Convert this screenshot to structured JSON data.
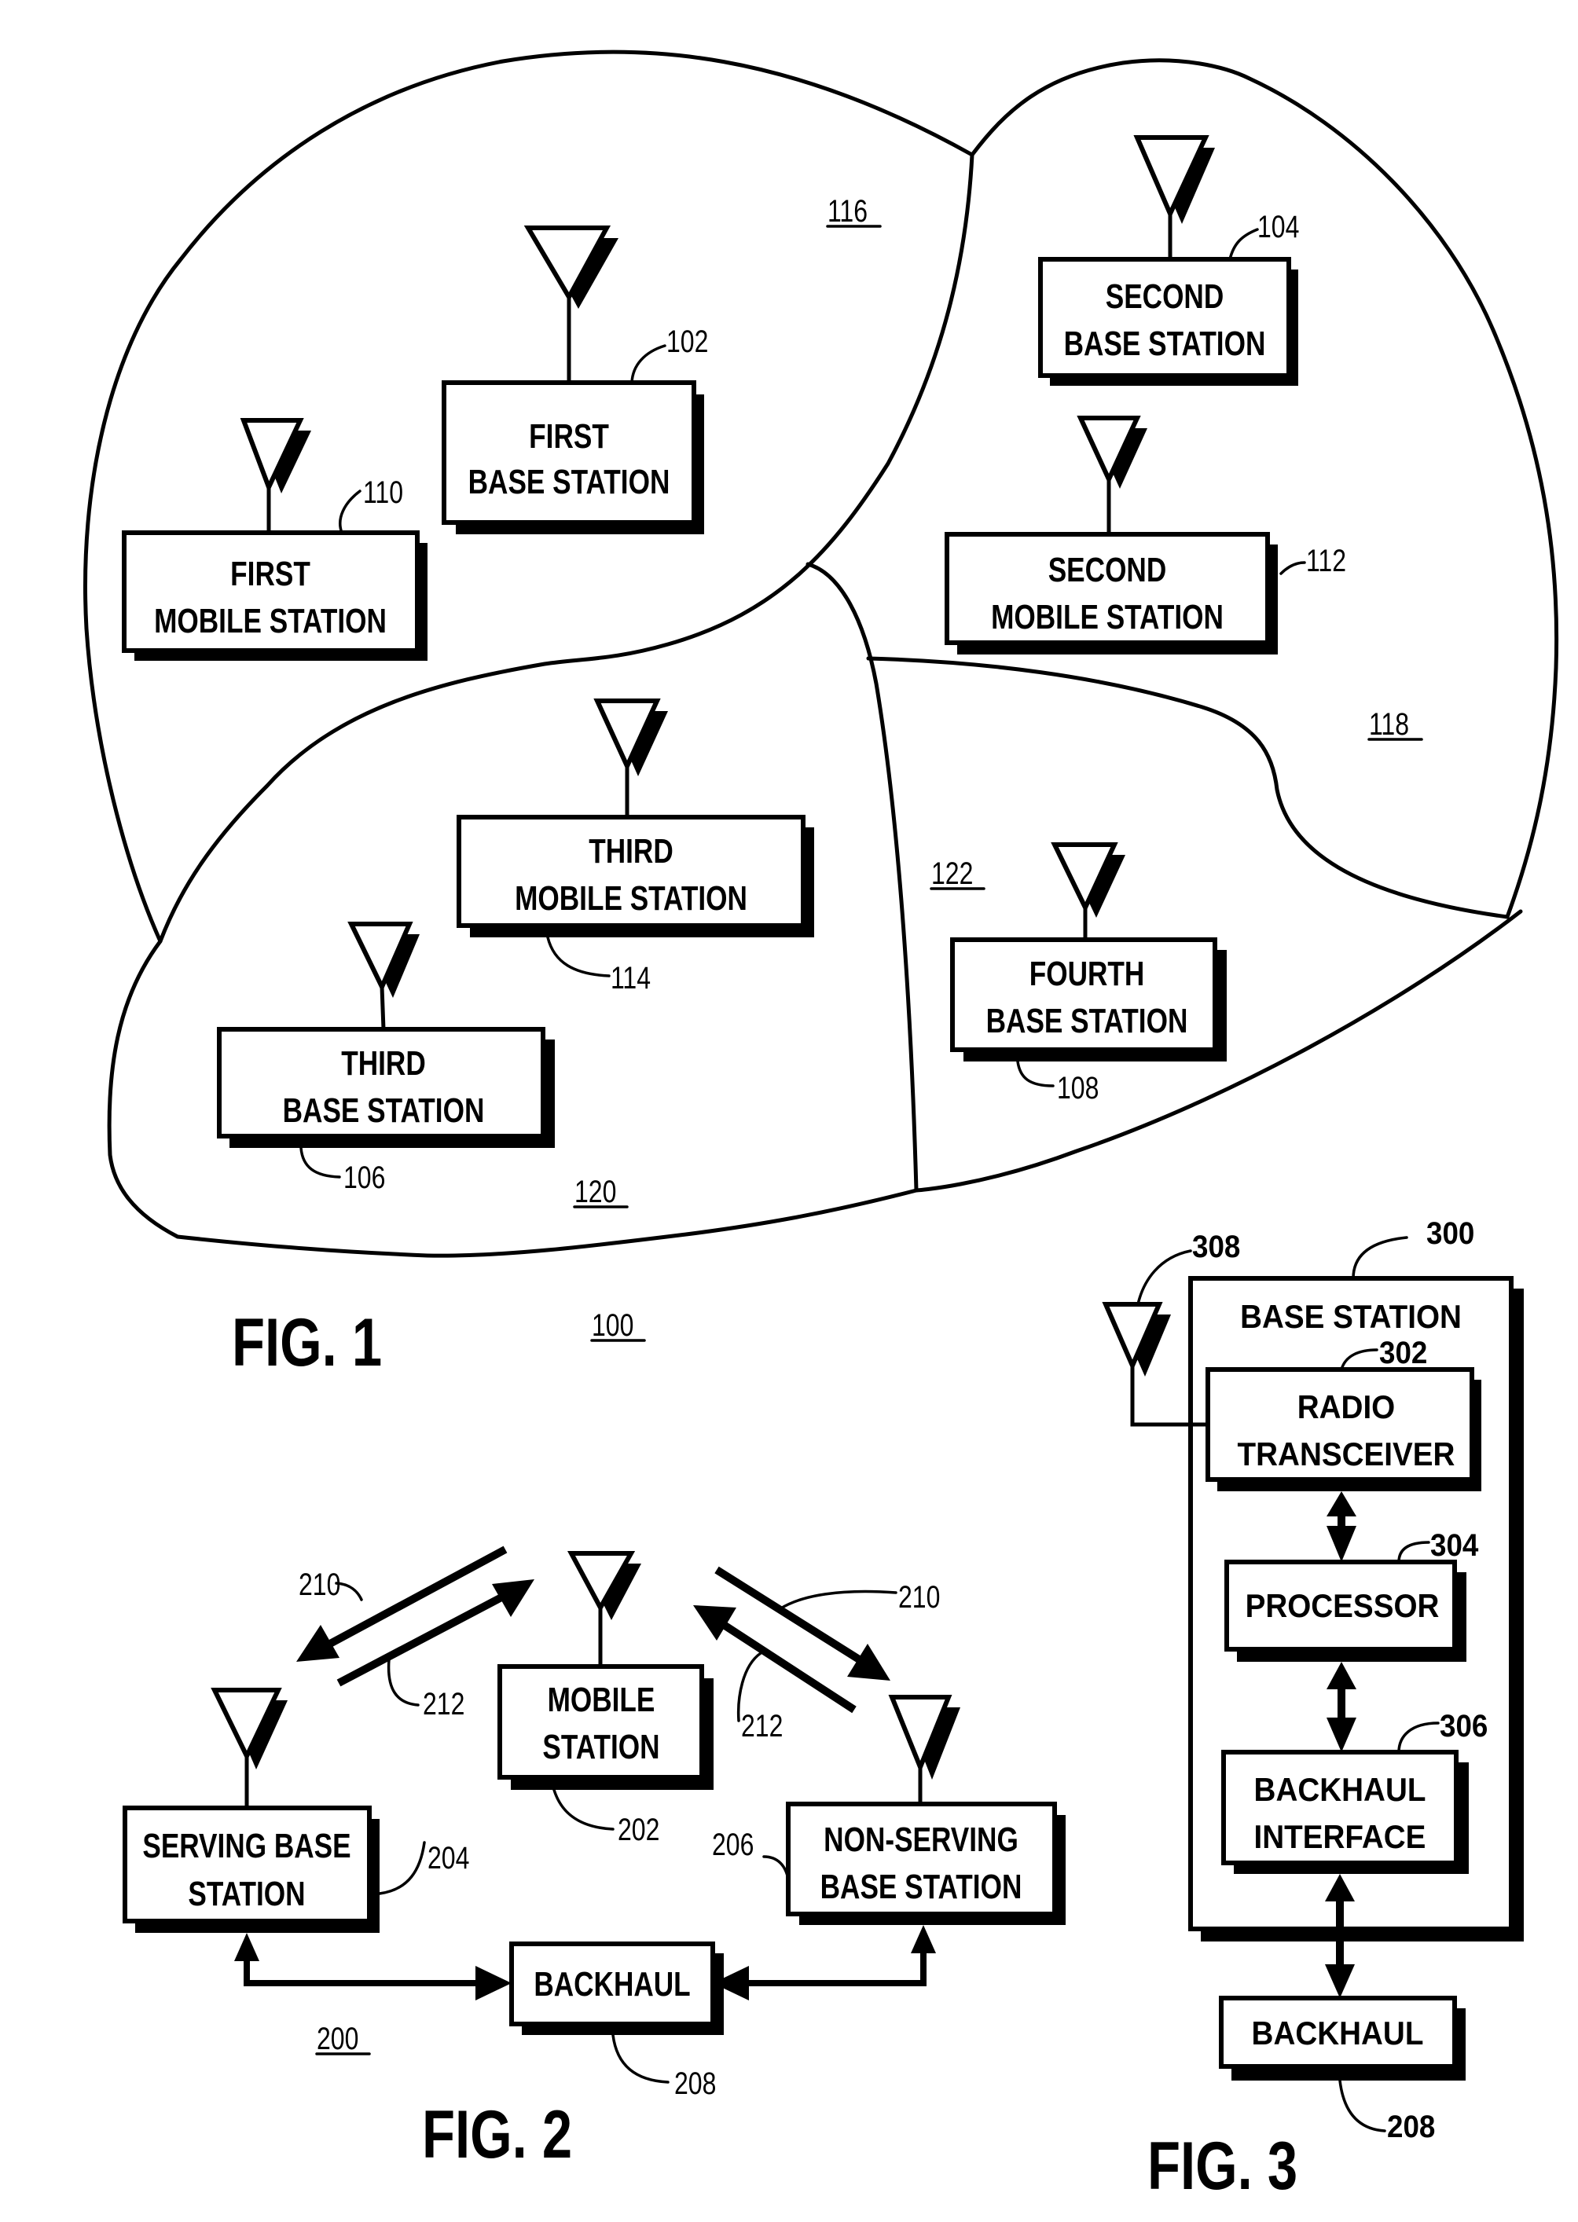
{
  "document": {
    "type": "patent drawing sheet",
    "background": "#ffffff",
    "ink": "#000000"
  },
  "fig1": {
    "caption": "FIG. 1",
    "ref": "100",
    "cells": [
      {
        "id": "cell-116",
        "ref": "116"
      },
      {
        "id": "cell-118",
        "ref": "118"
      },
      {
        "id": "cell-120",
        "ref": "120"
      },
      {
        "id": "cell-122",
        "ref": "122"
      }
    ],
    "nodes": [
      {
        "id": "first-base-station",
        "line1": "FIRST",
        "line2": "BASE STATION",
        "ref": "102"
      },
      {
        "id": "second-base-station",
        "line1": "SECOND",
        "line2": "BASE STATION",
        "ref": "104"
      },
      {
        "id": "third-base-station",
        "line1": "THIRD",
        "line2": "BASE STATION",
        "ref": "106"
      },
      {
        "id": "fourth-base-station",
        "line1": "FOURTH",
        "line2": "BASE  STATION",
        "ref": "108"
      },
      {
        "id": "first-mobile-station",
        "line1": "FIRST",
        "line2": "MOBILE STATION",
        "ref": "110"
      },
      {
        "id": "second-mobile-station",
        "line1": "SECOND",
        "line2": "MOBILE STATION",
        "ref": "112"
      },
      {
        "id": "third-mobile-station",
        "line1": "THIRD",
        "line2": "MOBILE STATION",
        "ref": "114"
      }
    ]
  },
  "fig2": {
    "caption": "FIG. 2",
    "ref": "200",
    "nodes": [
      {
        "id": "mobile-station",
        "line1": "MOBILE",
        "line2": "STATION",
        "ref": "202"
      },
      {
        "id": "serving-base-station",
        "line1": "SERVING BASE",
        "line2": "STATION",
        "ref": "204"
      },
      {
        "id": "non-serving-base-station",
        "line1": "NON-SERVING",
        "line2": "BASE STATION",
        "ref": "206"
      },
      {
        "id": "backhaul",
        "line1": "BACKHAUL",
        "ref": "208"
      }
    ],
    "links": [
      {
        "id": "downlink-left",
        "ref": "210"
      },
      {
        "id": "uplink-left",
        "ref": "212"
      },
      {
        "id": "downlink-right",
        "ref": "210"
      },
      {
        "id": "uplink-right",
        "ref": "212"
      }
    ]
  },
  "fig3": {
    "caption": "FIG. 3",
    "container": {
      "label": "BASE STATION",
      "ref": "300"
    },
    "antenna_ref": "308",
    "blocks": [
      {
        "id": "radio-transceiver",
        "line1": "RADIO",
        "line2": "TRANSCEIVER",
        "ref": "302"
      },
      {
        "id": "processor",
        "line1": "PROCESSOR",
        "ref": "304"
      },
      {
        "id": "backhaul-interface",
        "line1": "BACKHAUL",
        "line2": "INTERFACE",
        "ref": "306"
      }
    ],
    "external": {
      "id": "backhaul",
      "line1": "BACKHAUL",
      "ref": "208"
    }
  }
}
